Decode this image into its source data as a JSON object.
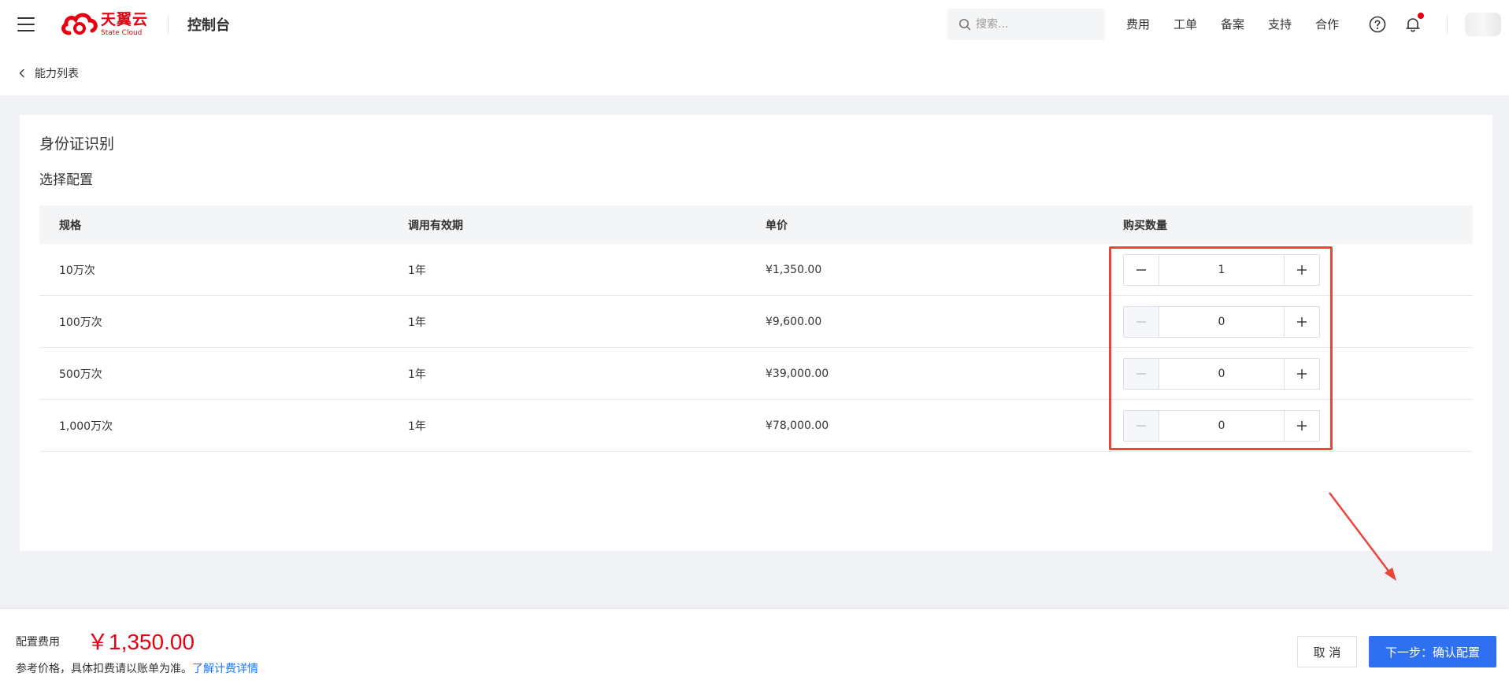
{
  "header": {
    "brand_cn": "天翼云",
    "brand_en": "State Cloud",
    "console_title": "控制台",
    "search_placeholder": "搜索...",
    "nav": [
      "费用",
      "工单",
      "备案",
      "支持",
      "合作"
    ],
    "icons": [
      "menu-icon",
      "search-icon",
      "help-icon",
      "bell-icon"
    ],
    "brand_color": "#e60012"
  },
  "breadcrumb": {
    "back_label": "能力列表"
  },
  "card": {
    "title": "身份证识别",
    "section_title": "选择配置",
    "columns": [
      "规格",
      "调用有效期",
      "单价",
      "购买数量"
    ],
    "rows": [
      {
        "spec": "10万次",
        "validity": "1年",
        "price": "¥1,350.00",
        "quantity": "1",
        "minus_disabled": false
      },
      {
        "spec": "100万次",
        "validity": "1年",
        "price": "¥9,600.00",
        "quantity": "0",
        "minus_disabled": true
      },
      {
        "spec": "500万次",
        "validity": "1年",
        "price": "¥39,000.00",
        "quantity": "0",
        "minus_disabled": true
      },
      {
        "spec": "1,000万次",
        "validity": "1年",
        "price": "¥78,000.00",
        "quantity": "0",
        "minus_disabled": true
      }
    ]
  },
  "annotation": {
    "color": "#e8453c"
  },
  "footer": {
    "fee_label": "配置费用",
    "fee_value": "￥1,350.00",
    "note": "参考价格，具体扣费请以账单为准。",
    "note_link": "了解计费详情",
    "cancel_label": "取 消",
    "next_label": "下一步：确认配置",
    "primary_color": "#2f6ff1"
  }
}
